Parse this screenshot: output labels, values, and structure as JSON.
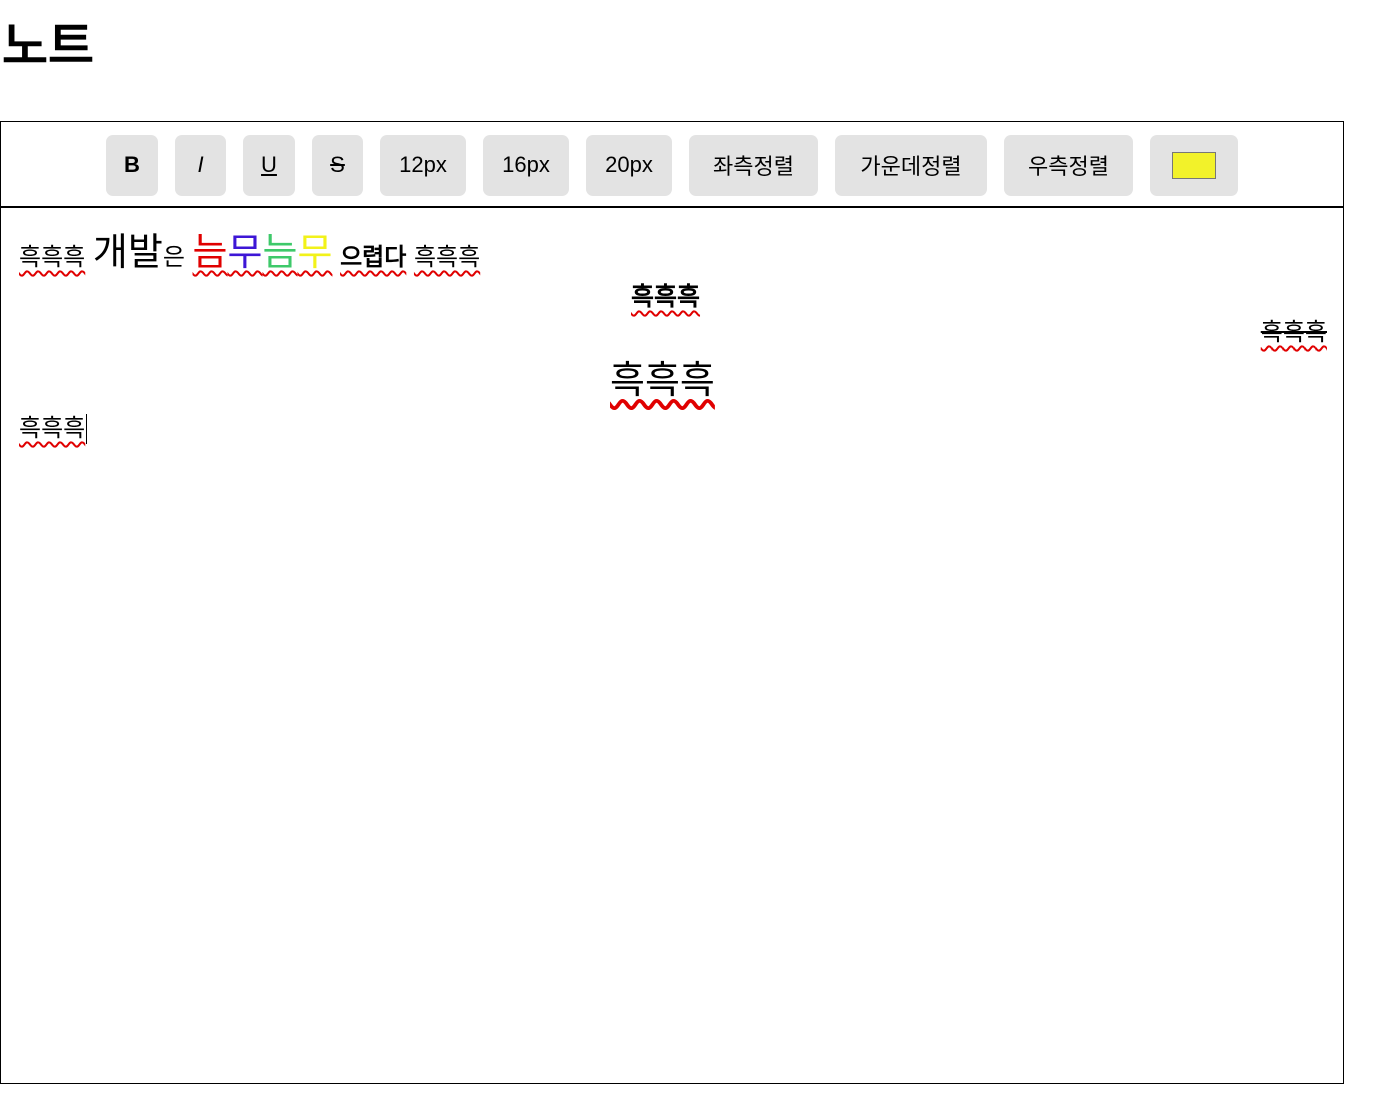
{
  "page": {
    "title": "노트"
  },
  "toolbar": {
    "bold": "B",
    "italic": "I",
    "underline": "U",
    "strike": "S",
    "size_12": "12px",
    "size_16": "16px",
    "size_20": "20px",
    "align_left": "좌측정렬",
    "align_center": "가운데정렬",
    "align_right": "우측정렬",
    "color_value": "#f2f22a"
  },
  "content": {
    "line1": {
      "seg1": "흑흑흑",
      "seg2": "개발",
      "seg3": "은",
      "seg4": "늠",
      "seg5": "무",
      "seg6": "늠",
      "seg7": "무",
      "seg8": "으렵다",
      "seg9": "흑흑흑"
    },
    "line2": "흑흑흑",
    "line3": "흑흑흑",
    "line4": "흑흑흑",
    "line5": "흑흑흑"
  },
  "colors": {
    "red": "#e00000",
    "blue": "#3d16d6",
    "green": "#3ec96a",
    "yellow": "#f2f21a"
  }
}
